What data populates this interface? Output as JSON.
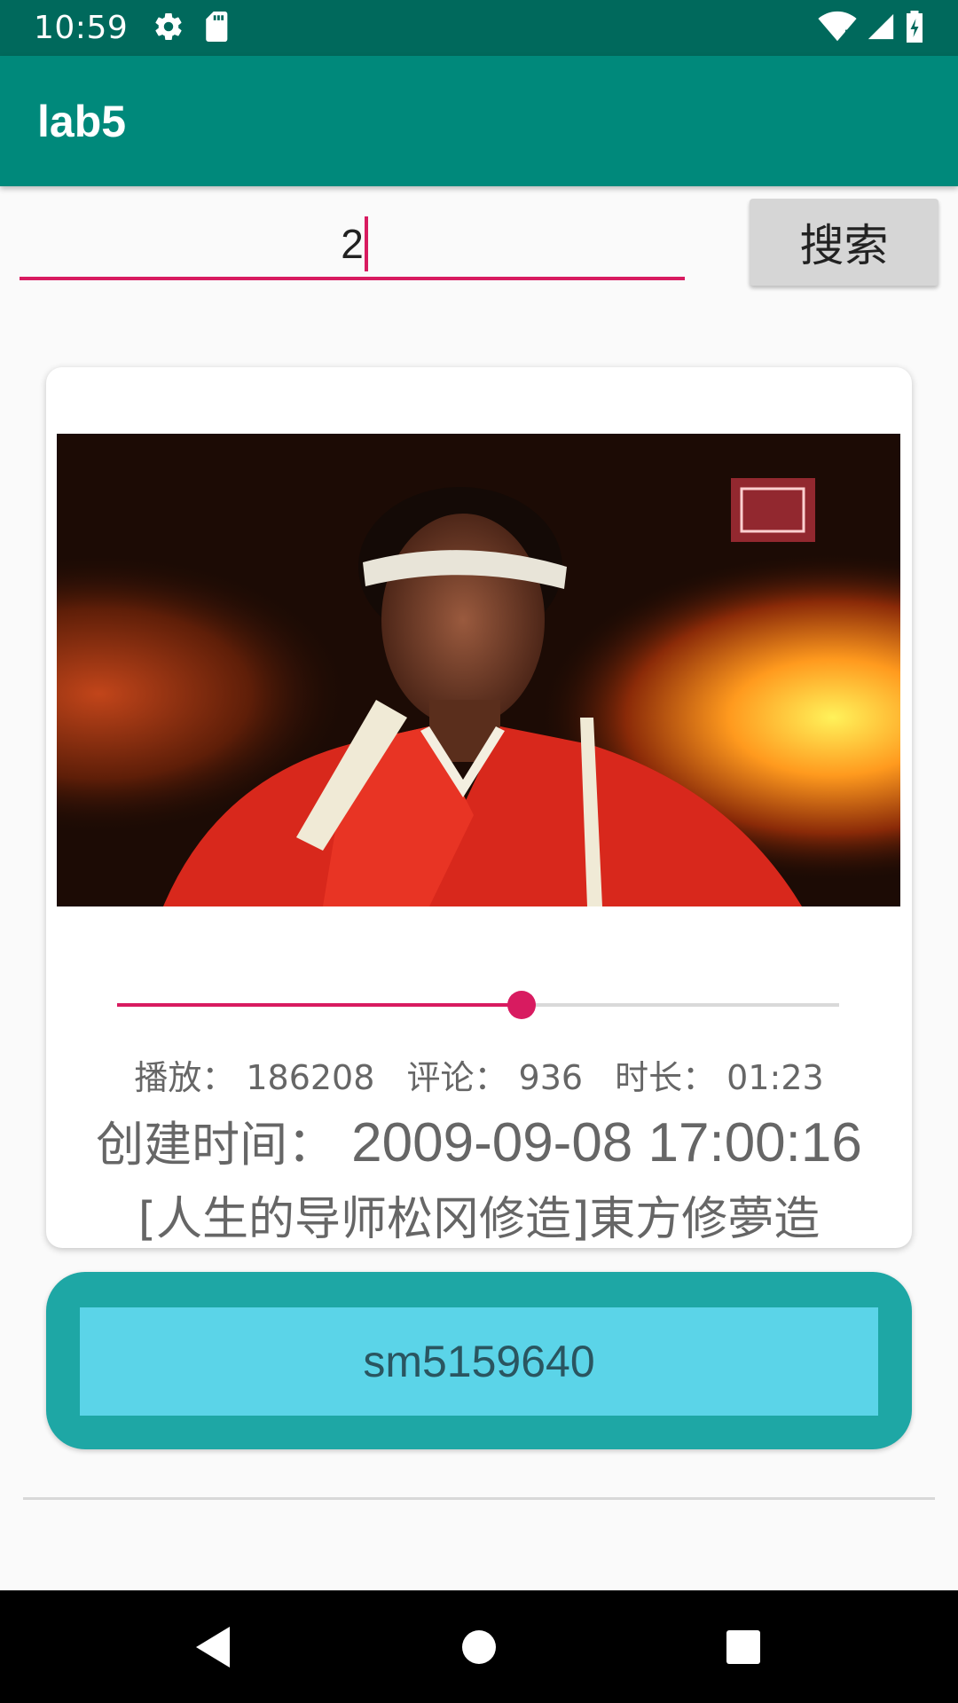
{
  "status_bar": {
    "time": "10:59",
    "icons_left": [
      "settings-icon",
      "sd-card-icon"
    ],
    "icons_right": [
      "wifi-icon",
      "signal-icon",
      "battery-icon"
    ]
  },
  "app_bar": {
    "title": "lab5"
  },
  "search": {
    "value": "2",
    "button_label": "搜索"
  },
  "card": {
    "progress": 0.56,
    "stats": {
      "plays_label": "播放：",
      "plays_value": "186208",
      "comments_label": "评论：",
      "comments_value": "936",
      "duration_label": "时长：",
      "duration_value": "01:23"
    },
    "created_label": "创建时间：",
    "created_value": "2009-09-08 17:00:16",
    "title": "[人生的导师松冈修造]東方修夢造"
  },
  "id_panel": {
    "id": "sm5159640"
  },
  "colors": {
    "status_bar": "#00695c",
    "app_bar": "#00897b",
    "accent": "#d81b60",
    "id_panel": "#1ea7a5",
    "id_box": "#5bd4e8"
  },
  "nav_bar": {
    "buttons": [
      "back-icon",
      "home-icon",
      "recents-icon"
    ]
  }
}
